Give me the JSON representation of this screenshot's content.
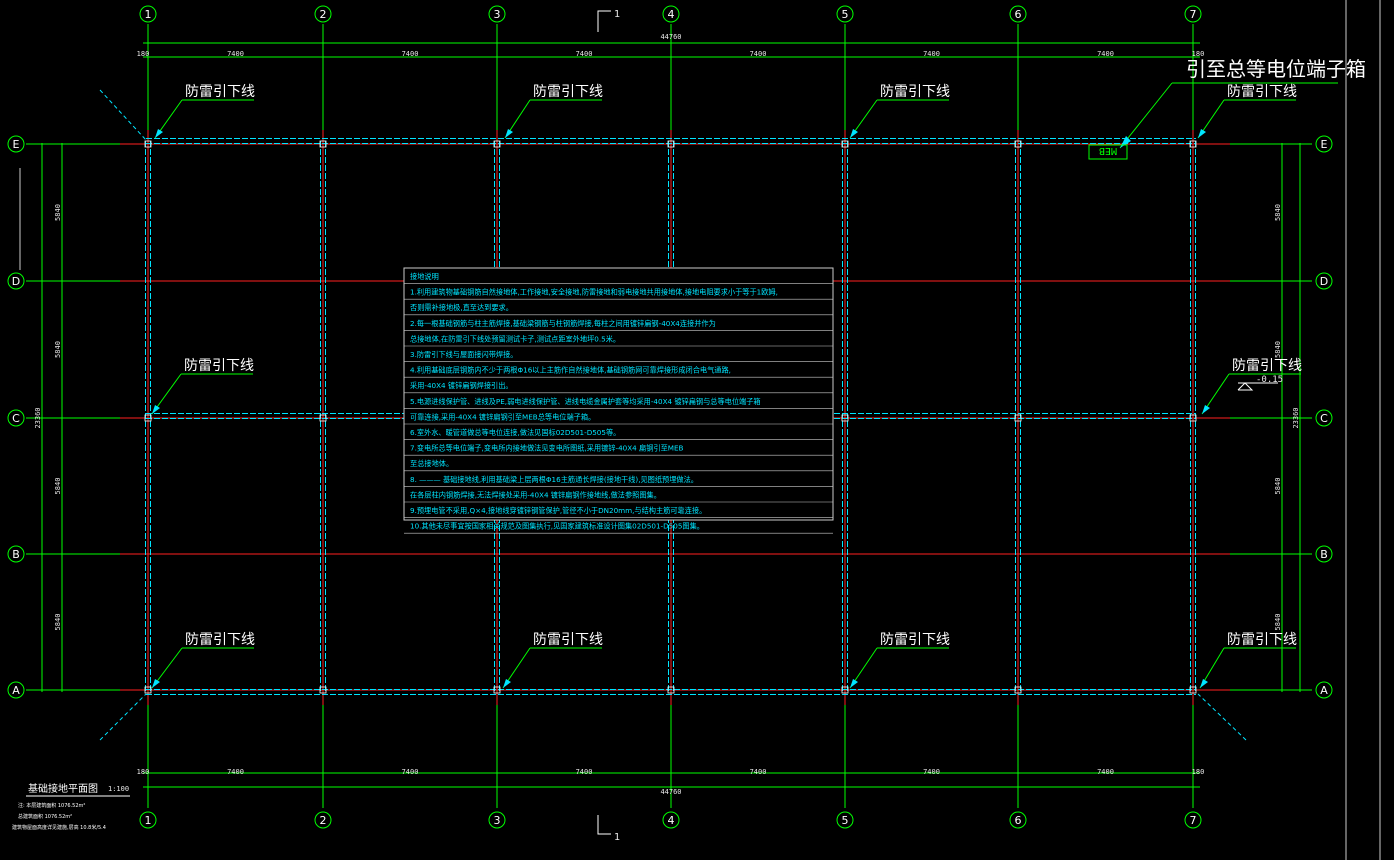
{
  "colors": {
    "background": "#000000",
    "grid_axis": "#00ff00",
    "beam_red": "#ff2020",
    "ground_cyan": "#00e5ff",
    "dim_white": "#e8e8e8",
    "notes_border": "#cccccc",
    "label_green_leader": "#00ff00"
  },
  "column_axes": [
    "1",
    "2",
    "3",
    "4",
    "5",
    "6",
    "7"
  ],
  "row_axes": [
    "E",
    "D",
    "C",
    "B",
    "A"
  ],
  "dimensions": {
    "top_total": "44760",
    "bottom_total": "44760",
    "end_offset": "180",
    "bay_width": "7400",
    "side_total": "23360",
    "side_bay": "5840"
  },
  "section_mark": "1",
  "downlead_label": "防雷引下线",
  "meb_callout": "引至总等电位端子箱",
  "meb_box": "MEB",
  "level_mark": "-0.15",
  "notes": {
    "title": "接地说明",
    "lines": [
      "1.利用建筑物基础钢筋自然接地体,工作接地,安全接地,防雷接地和弱电接地共用接地体,接地电阻要求小于等于1欧姆,",
      "否则需补接地极,直至达到要求。",
      "2.每一根基础钢筋与柱主筋焊接,基础梁钢筋与柱钢筋焊接,每柱之间用镀锌扁钢-40X4连接并作为",
      "总接地体,在防雷引下线处预留测试卡子,测试点距室外地坪0.5米。",
      "3.防雷引下线与屋面接闪带焊接。",
      "4.利用基础底层钢筋内不少于两根Φ16以上主筋作自然接地体,基础钢筋网可靠焊接形成闭合电气通路,",
      "采用-40X4 镀锌扁钢焊接引出。",
      "5.电源进线保护管、进线及PE,弱电进线保护管、进线电缆金属护套等均采用-40X4 镀锌扁钢与总等电位端子箱",
      "可靠连接,采用-40X4 镀锌扁钢引至MEB总等电位端子箱。",
      "6.室外水、暖管道做总等电位连接,做法见国标02D501-D505等。",
      "7.变电所总等电位端子,变电所内接地做法见变电所图纸,采用镀锌-40X4 扁钢引至MEB",
      "至总接地体。",
      "8.  ——— 基础接地线,利用基础梁上层两根Φ16主筋通长焊接(接地干线),见图纸预埋做法。",
      "在各层柱内钢筋焊接,无法焊接处采用-40X4 镀锌扁钢作接地线,做法参照图集。",
      "9.预埋电管不采用,Q×4,接地线穿镀锌钢管保护,管径不小于DN20mm,与结构主筋可靠连接。",
      "10.其他未尽事宜按国家相关规范及图集执行,见国家建筑标准设计图集02D501-D505图集。"
    ]
  },
  "title_block": {
    "title": "基础接地平面图",
    "scale": "1:100",
    "note1": "注: 本层建筑面积 1076.52m²",
    "note2": "总建筑面积 1076.52m²",
    "note3": "建筑物屋面高度详见建施,层高 10.8米/5.4"
  }
}
